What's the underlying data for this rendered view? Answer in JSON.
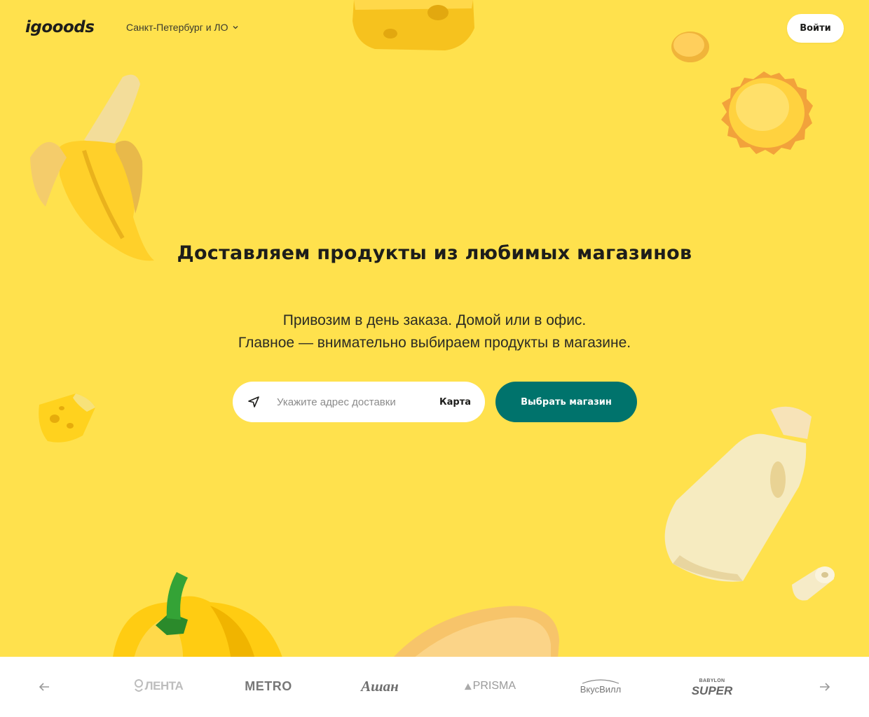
{
  "header": {
    "logo": "igooods",
    "city": "Санкт-Петербург и ЛО",
    "login_label": "Войти"
  },
  "hero": {
    "title": "Доставляем продукты из любимых магазинов",
    "subtitle_line1": "Привозим в день заказа. Домой или в офис.",
    "subtitle_line2": "Главное — внимательно выбираем продукты в магазине."
  },
  "search": {
    "placeholder": "Укажите адрес доставки",
    "value": "",
    "map_label": "Карта",
    "icon": "navigation-arrow-icon"
  },
  "cta": {
    "choose_store_label": "Выбрать магазин"
  },
  "stores": {
    "prev_icon": "arrow-left-icon",
    "next_icon": "arrow-right-icon",
    "items": [
      {
        "name": "ЛЕНТА"
      },
      {
        "name": "METRO"
      },
      {
        "name": "Ашан"
      },
      {
        "name": "PRISMA"
      },
      {
        "name": "ВкусВилл"
      },
      {
        "name": "SUPER",
        "prefix": "BABYLON"
      }
    ]
  },
  "colors": {
    "background": "#ffe14d",
    "accent": "#00736c",
    "white": "#ffffff"
  }
}
